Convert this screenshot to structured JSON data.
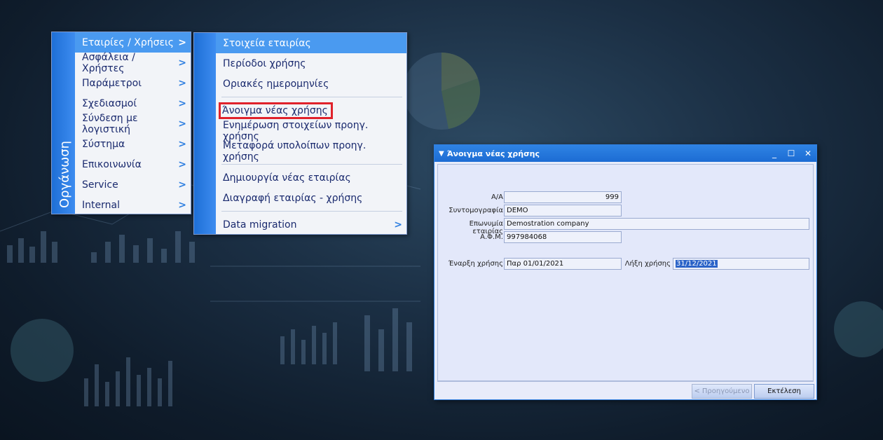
{
  "main_menu": {
    "strip_label": "Οργάνωση",
    "items": [
      {
        "label": "Εταιρίες / Χρήσεις"
      },
      {
        "label": "Ασφάλεια / Χρήστες"
      },
      {
        "label": "Παράμετροι"
      },
      {
        "label": "Σχεδιασμοί"
      },
      {
        "label": "Σύνδεση με λογιστική"
      },
      {
        "label": "Σύστημα"
      },
      {
        "label": "Επικοινωνία"
      },
      {
        "label": "Service"
      },
      {
        "label": "Internal"
      }
    ]
  },
  "sub_menu": {
    "items": [
      {
        "label": "Στοιχεία εταιρίας"
      },
      {
        "label": "Περίοδοι χρήσης"
      },
      {
        "label": "Οριακές ημερομηνίες"
      },
      {
        "label": "Άνοιγμα νέας χρήσης"
      },
      {
        "label": "Ενημέρωση στοιχείων προηγ. χρήσης"
      },
      {
        "label": "Μεταφορά υπολοίπων προηγ. χρήσης"
      },
      {
        "label": "Δημιουργία νέας εταιρίας"
      },
      {
        "label": "Διαγραφή εταιρίας - χρήσης"
      },
      {
        "label": "Data migration"
      }
    ]
  },
  "dialog": {
    "title": "Άνοιγμα νέας χρήσης",
    "fields": {
      "aa": {
        "label": "Α/Α",
        "value": "999"
      },
      "short_name": {
        "label": "Συντομογραφία",
        "value": "DEMO"
      },
      "company_name": {
        "label": "Επωνυμία εταιρίας",
        "value": "Demostration company"
      },
      "afm": {
        "label": "Α.Φ.Μ.",
        "value": "997984068"
      },
      "start": {
        "label": "Έναρξη χρήσης",
        "value": "Παρ 01/01/2021"
      },
      "end": {
        "label": "Λήξη χρήσης",
        "value": "31/12/2021"
      }
    },
    "buttons": {
      "previous": "Προηγούμενο",
      "execute": "Εκτέλεση"
    }
  },
  "colors": {
    "menu_strip": "#2f7fe0",
    "highlight": "#4a9af0",
    "callout_border": "#e0222b"
  }
}
